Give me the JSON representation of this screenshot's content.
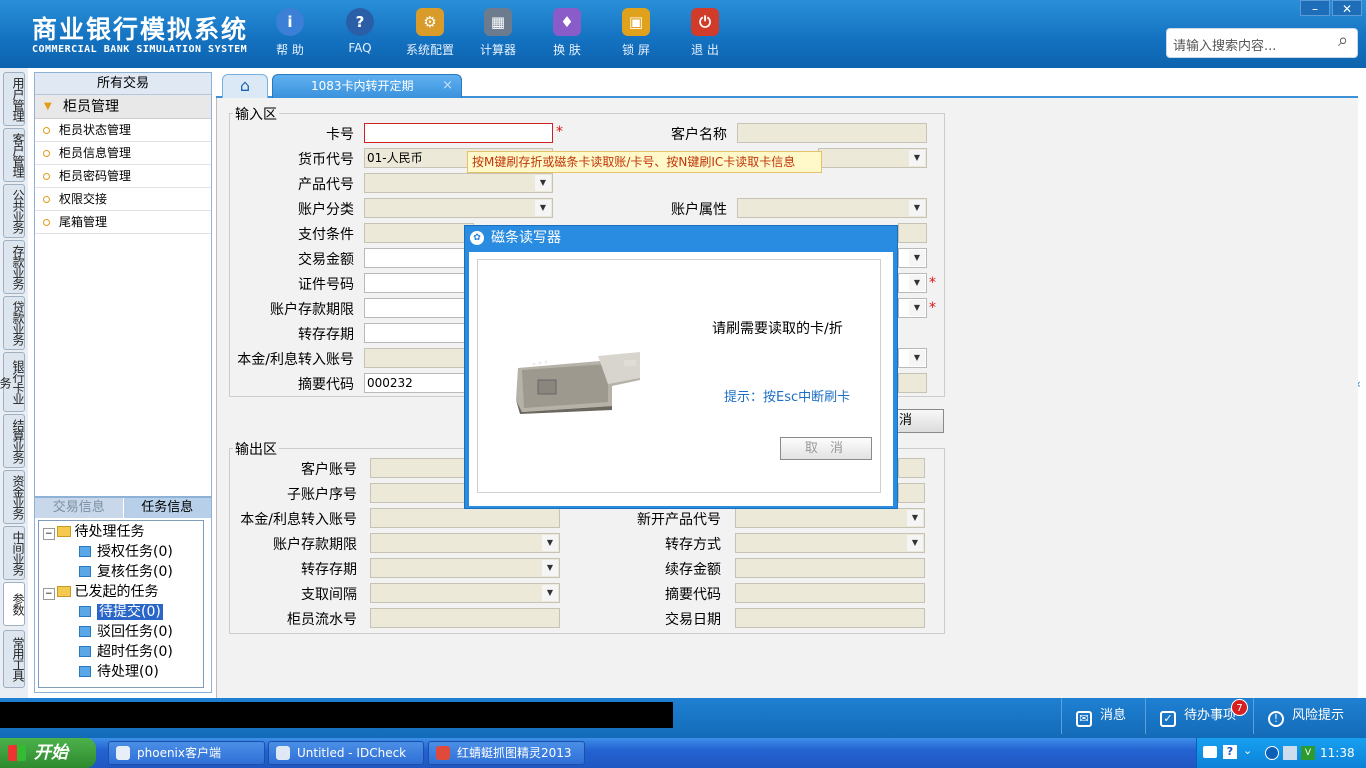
{
  "header": {
    "title_cn": "商业银行模拟系统",
    "title_en": "COMMERCIAL BANK SIMULATION SYSTEM",
    "toolbar": [
      {
        "label": "帮 助",
        "icon": "help-icon",
        "color": "#3b7fd6",
        "glyph": "i"
      },
      {
        "label": "FAQ",
        "icon": "faq-icon",
        "color": "#2a5fa8",
        "glyph": "?"
      },
      {
        "label": "系统配置",
        "icon": "config-icon",
        "color": "#d99b2a",
        "glyph": "⚙"
      },
      {
        "label": "计算器",
        "icon": "calculator-icon",
        "color": "#6c7c8e",
        "glyph": "▦"
      },
      {
        "label": "换 肤",
        "icon": "skin-icon",
        "color": "#8a5cc9",
        "glyph": "♦"
      },
      {
        "label": "锁 屏",
        "icon": "lock-icon",
        "color": "#e0a21d",
        "glyph": "▣"
      },
      {
        "label": "退 出",
        "icon": "exit-icon",
        "color": "#d13b2a",
        "glyph": "⏻"
      }
    ],
    "search_placeholder": "请输入搜索内容...",
    "window_minimize": "–",
    "window_close": "✕"
  },
  "left_strip": [
    "用户管理",
    "客户管理",
    "公共业务",
    "存款业务",
    "贷款业务",
    "银行卡业务",
    "结算业务",
    "资金业务",
    "中间业务",
    "参数",
    "常用工具"
  ],
  "left_panel": {
    "title": "所有交易",
    "group": "柜员管理",
    "items": [
      "柜员状态管理",
      "柜员信息管理",
      "柜员密码管理",
      "权限交接",
      "尾箱管理"
    ]
  },
  "task_panel": {
    "tab_inactive": "交易信息",
    "tab_active": "任务信息",
    "tree": [
      {
        "label": "待处理任务",
        "type": "folder",
        "level": 0
      },
      {
        "label": "授权任务(0)",
        "type": "doc",
        "level": 1
      },
      {
        "label": "复核任务(0)",
        "type": "doc",
        "level": 1
      },
      {
        "label": "已发起的任务",
        "type": "folder",
        "level": 0
      },
      {
        "label": "待提交(0)",
        "type": "doc",
        "level": 1,
        "selected": true
      },
      {
        "label": "驳回任务(0)",
        "type": "doc",
        "level": 1
      },
      {
        "label": "超时任务(0)",
        "type": "doc",
        "level": 1
      },
      {
        "label": "待处理(0)",
        "type": "doc",
        "level": 1
      }
    ]
  },
  "tabs": {
    "home_icon": "⌂",
    "active": "1083卡内转开定期",
    "close": "×"
  },
  "input_area": {
    "legend": "输入区",
    "left_labels": [
      "卡号",
      "货币代号",
      "产品代号",
      "账户分类",
      "支付条件",
      "交易金额",
      "证件号码",
      "账户存款期限",
      "转存存期",
      "本金/利息转入账号",
      "摘要代码"
    ],
    "right_labels": [
      "客户名称",
      "账户属性"
    ],
    "currency_value": "01-人民币",
    "summary_code_value": "000232",
    "required_mark": "*",
    "tooltip": "按M键刷存折或磁条卡读取账/卡号、按N键刷IC卡读取卡信息",
    "cancel_button_fragment": "消"
  },
  "output_area": {
    "legend": "输出区",
    "left_labels": [
      "客户账号",
      "子账户序号",
      "本金/利息转入账号",
      "账户存款期限",
      "转存存期",
      "支取间隔",
      "柜员流水号"
    ],
    "right_labels": [
      "新开产品代号",
      "转存方式",
      "续存金额",
      "摘要代码",
      "交易日期"
    ]
  },
  "dialog": {
    "title": "磁条读写器",
    "message": "请刷需要读取的卡/折",
    "hint": "提示：按Esc中断刷卡",
    "cancel": "取 消"
  },
  "statusbar": {
    "messages": "消息",
    "todo": "待办事项",
    "todo_count": "7",
    "risk": "风险提示"
  },
  "taskbar": {
    "start": "开始",
    "apps": [
      {
        "label": "phoenix客户端",
        "icon": "phoenix-icon",
        "color": "#e8eef7"
      },
      {
        "label": "Untitled - IDCheck",
        "icon": "idcheck-icon",
        "color": "#dfe8f5"
      },
      {
        "label": "红蜻蜓抓图精灵2013",
        "icon": "snapshot-icon",
        "color": "#e04a3a"
      }
    ],
    "clock": "11:38"
  }
}
